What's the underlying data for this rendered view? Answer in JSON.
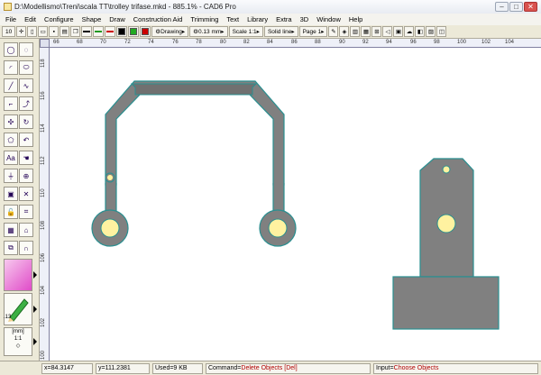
{
  "window": {
    "title": "D:\\Modellismo\\Treni\\scala TT\\trolley trifase.mkd - 885.1% - CAD6 Pro"
  },
  "menu": {
    "items": [
      "File",
      "Edit",
      "Configure",
      "Shape",
      "Draw",
      "Construction Aid",
      "Trimming",
      "Text",
      "Library",
      "Extra",
      "3D",
      "Window",
      "Help"
    ]
  },
  "toolbar": {
    "grid_value": "10",
    "layer_label": "Drawing",
    "pen_width": "0.13 mm",
    "scale": "Scale 1:1",
    "line_style": "Solid line",
    "page": "Page 1",
    "colors": [
      "#000000",
      "#22aa22",
      "#cc0000"
    ]
  },
  "leftbar": {
    "pen_width_label": ".13"
  },
  "rulers": {
    "h_ticks": [
      "66",
      "68",
      "70",
      "72",
      "74",
      "76",
      "78",
      "80",
      "82",
      "84",
      "86",
      "88",
      "90",
      "92",
      "94",
      "96",
      "98",
      "100",
      "102",
      "104"
    ],
    "v_ticks": [
      "118",
      "116",
      "114",
      "112",
      "110",
      "108",
      "106",
      "104",
      "102",
      "100"
    ]
  },
  "status": {
    "x": "x=84.3147",
    "y": "y=111.2381",
    "used": "Used=9 KB",
    "command_label": "Command=",
    "command_value": "Delete Objects [Del]",
    "input_label": "Input=",
    "input_value": "Choose Objects"
  },
  "drawing": {
    "fill_color": "#808080",
    "outline_color": "#2a8f90",
    "hole_color": "#fff2a0"
  }
}
